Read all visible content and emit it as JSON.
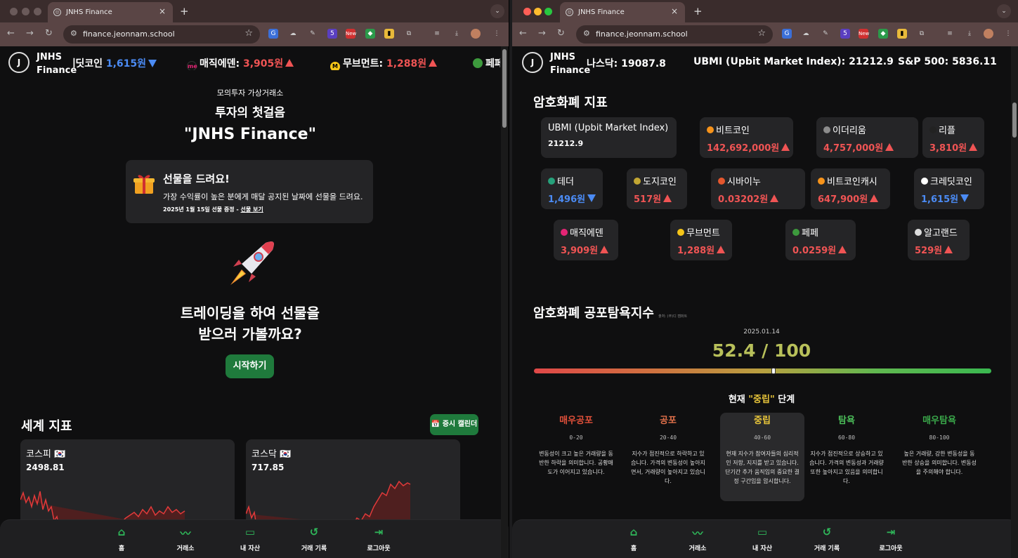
{
  "browser": {
    "tab_title": "JNHS Finance",
    "url": "finance.jeonnam.school"
  },
  "brand": {
    "name_line1": "JNHS",
    "name_line2": "Finance"
  },
  "left": {
    "ticker": [
      {
        "name": "크레딧코인:",
        "price": "1,615원",
        "dir": "down"
      },
      {
        "name": "매직에덴:",
        "price": "3,905원",
        "dir": "up"
      },
      {
        "name": "무브먼트:",
        "price": "1,288원",
        "dir": "up"
      },
      {
        "name": "페페",
        "price": "",
        "dir": ""
      }
    ],
    "hero": {
      "subtitle": "모의투자 가상거래소",
      "line2": "투자의 첫걸음",
      "title": "\"JNHS Finance\""
    },
    "gift": {
      "title": "선물을 드려요!",
      "desc": "가장 수익률이 높은 분에게 매달 공지된 날짜에 선물을 드려요.",
      "note": "2025년 1월 15일 선물 증정 - ",
      "link": "선물 보기"
    },
    "cta": {
      "line1": "트레이딩을 하여 선물을",
      "line2": "받으러 가볼까요?",
      "button": "시작하기"
    },
    "world": {
      "title": "세계 지표",
      "calendar_button": "증시 캘린더",
      "cards": [
        {
          "name": "코스피 🇰🇷",
          "value": "2498.81"
        },
        {
          "name": "코스닥 🇰🇷",
          "value": "717.85"
        }
      ]
    }
  },
  "right": {
    "ticker": [
      {
        "text": "나스닥: 19087.8"
      },
      {
        "text": "UBMI (Upbit Market Index): 21212.9"
      },
      {
        "text": "S&P 500: 5836.11"
      }
    ],
    "crypto_title": "암호화폐 지표",
    "ubmi": {
      "name": "UBMI (Upbit Market Index)",
      "value": "21212.9"
    },
    "coins": [
      {
        "name": "비트코인",
        "price": "142,692,000원",
        "dir": "up",
        "color": "#f7931a"
      },
      {
        "name": "이더리움",
        "price": "4,757,000원",
        "dir": "up",
        "color": "#8c8c8c"
      },
      {
        "name": "리플",
        "price": "3,810원",
        "dir": "up",
        "color": "#222222"
      },
      {
        "name": "테더",
        "price": "1,496원",
        "dir": "down",
        "color": "#26a17b"
      },
      {
        "name": "도지코인",
        "price": "517원",
        "dir": "up",
        "color": "#c2a633"
      },
      {
        "name": "시바이누",
        "price": "0.03202원",
        "dir": "up",
        "color": "#e4572e"
      },
      {
        "name": "비트코인캐시",
        "price": "647,900원",
        "dir": "up",
        "color": "#f7931a"
      },
      {
        "name": "크레딧코인",
        "price": "1,615원",
        "dir": "down",
        "color": "#ffffff"
      },
      {
        "name": "매직에덴",
        "price": "3,909원",
        "dir": "up",
        "color": "#e42575"
      },
      {
        "name": "무브먼트",
        "price": "1,288원",
        "dir": "up",
        "color": "#f5c518"
      },
      {
        "name": "페페",
        "price": "0.0259원",
        "dir": "up",
        "color": "#3d9a3d"
      },
      {
        "name": "알고랜드",
        "price": "529원",
        "dir": "up",
        "color": "#dddddd"
      }
    ],
    "fear_greed": {
      "title": "암호화폐 공포탐욕지수",
      "source": "출처: (주)디 캠퍼트",
      "date": "2025.01.14",
      "score": "52.4 / 100",
      "value": 52.4,
      "max": 100,
      "current_prefix": "현재 ",
      "current_stage": "\"중립\"",
      "current_suffix": " 단계",
      "stages": [
        {
          "name": "매우공포",
          "range": "0-20",
          "color": "#e0503a",
          "desc": "변동성이 크고 높은 거래량을 동반한 하락을 의미합니다. 공황매도가 이어지고 있습니다."
        },
        {
          "name": "공포",
          "range": "20-40",
          "color": "#e0704a",
          "desc": "지수가 점진적으로 하락하고 있습니다. 가격의 변동성이 높아지면서, 거래량이 높아지고 있습니다."
        },
        {
          "name": "중립",
          "range": "40-60",
          "color": "#e8c53a",
          "desc": "현재 지수가 참여자들의 심리적인 저항, 지지를 받고 있습니다. 단기간 추가 움직임의 중요한 결정 구간임을 암시합니다."
        },
        {
          "name": "탐욕",
          "range": "60-80",
          "color": "#4cbf5a",
          "desc": "지수가 점진적으로 상승하고 있습니다. 가격의 변동성과 거래량 또한 높아지고 있음을 의미합니다."
        },
        {
          "name": "매우탐욕",
          "range": "80-100",
          "color": "#3aa84a",
          "desc": "높은 거래량, 강한 변동성을 동반한 상승을 의미합니다. 변동성을 주의해야 합니다."
        }
      ]
    }
  },
  "bottom_nav": [
    {
      "label": "홈",
      "icon": "home-icon"
    },
    {
      "label": "거래소",
      "icon": "chart-line-icon"
    },
    {
      "label": "내 자산",
      "icon": "wallet-icon"
    },
    {
      "label": "거래 기록",
      "icon": "history-icon"
    },
    {
      "label": "로그아웃",
      "icon": "logout-icon"
    }
  ]
}
